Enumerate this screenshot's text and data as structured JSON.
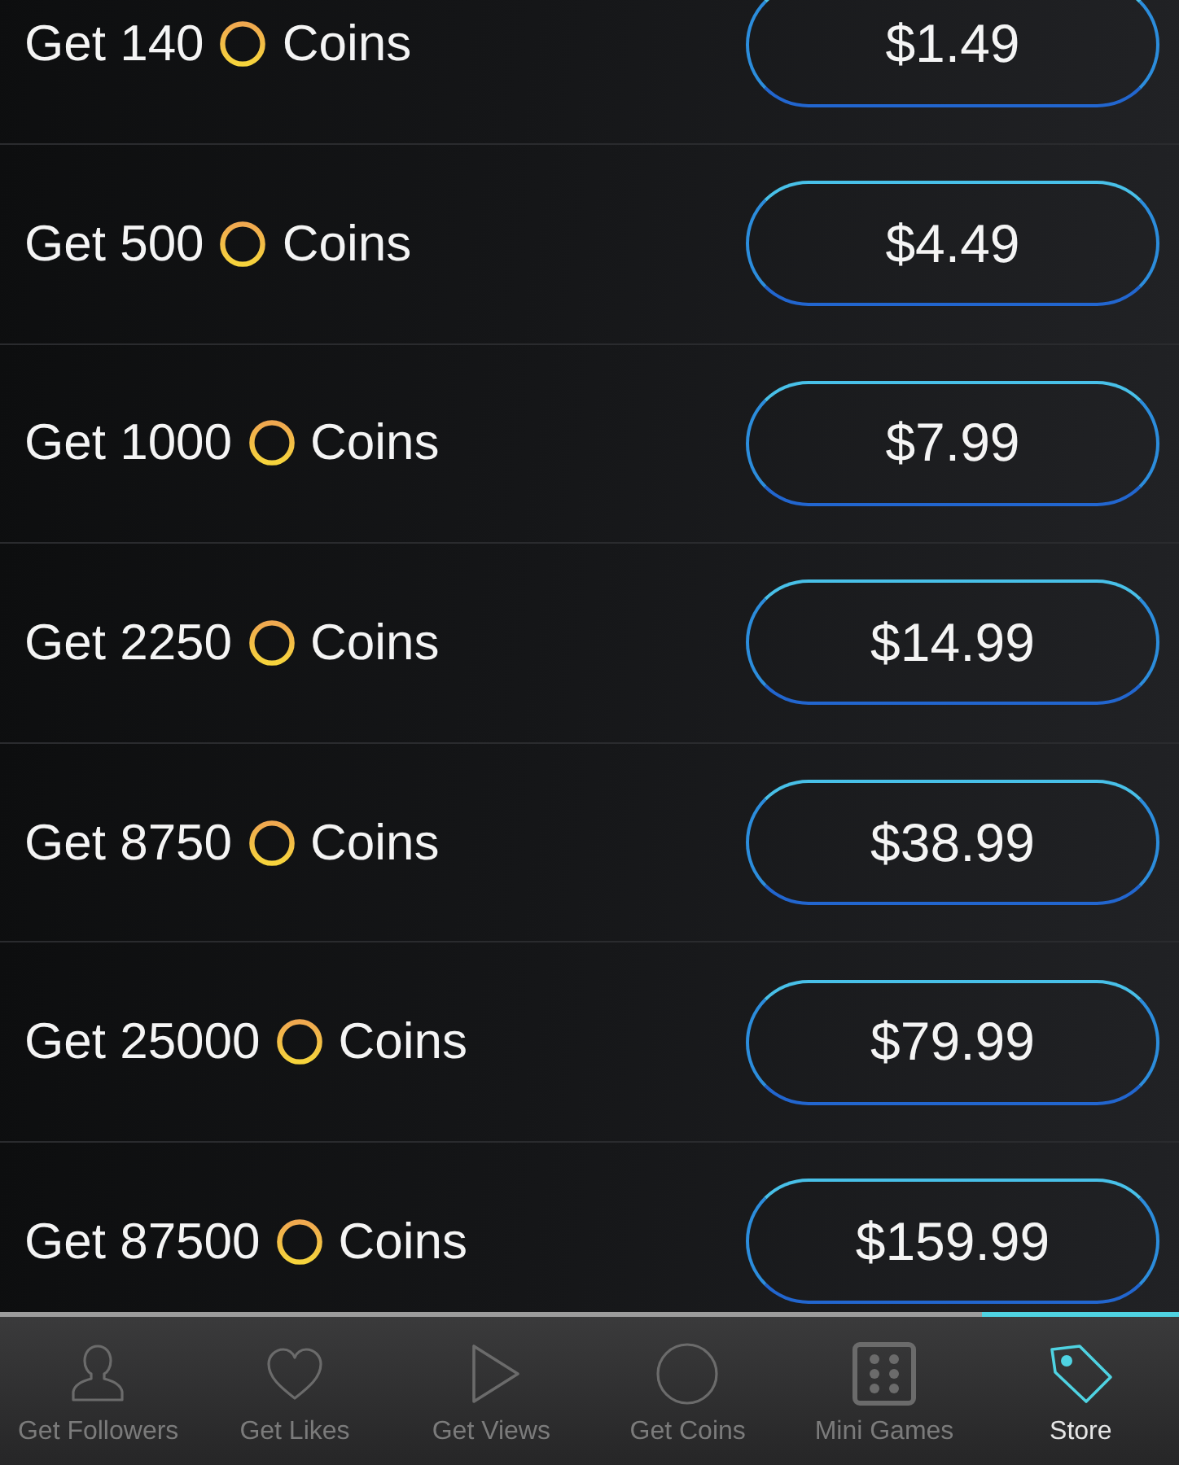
{
  "products": [
    {
      "label_before": "Get 140",
      "label_after": "Coins",
      "price": "$1.49"
    },
    {
      "label_before": "Get 500",
      "label_after": "Coins",
      "price": "$4.49"
    },
    {
      "label_before": "Get 1000",
      "label_after": "Coins",
      "price": "$7.99"
    },
    {
      "label_before": "Get 2250",
      "label_after": "Coins",
      "price": "$14.99"
    },
    {
      "label_before": "Get 8750",
      "label_after": "Coins",
      "price": "$38.99"
    },
    {
      "label_before": "Get 25000",
      "label_after": "Coins",
      "price": "$79.99"
    },
    {
      "label_before": "Get 87500",
      "label_after": "Coins",
      "price": "$159.99"
    }
  ],
  "tab_bar": {
    "tabs": [
      {
        "label": "Get Followers",
        "selected": false
      },
      {
        "label": "Get Likes",
        "selected": false
      },
      {
        "label": "Get Views",
        "selected": false
      },
      {
        "label": "Get Coins",
        "selected": false
      },
      {
        "label": "Mini Games",
        "selected": false
      },
      {
        "label": "Store",
        "selected": true
      }
    ]
  }
}
